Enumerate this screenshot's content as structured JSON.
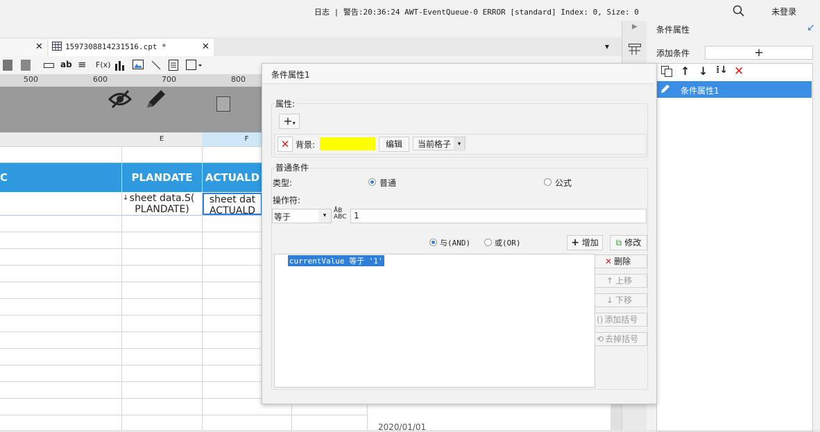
{
  "topbar": {
    "log": "日志 | 警告:20:36:24 AWT-EventQueue-0 ERROR [standard] Index: 0, Size: 0",
    "login": "未登录"
  },
  "tabs": [
    {
      "label": "1597308814231516.cpt *"
    }
  ],
  "ruler": [
    "500",
    "600",
    "700",
    "800"
  ],
  "grid": {
    "columns": [
      "E",
      "F"
    ],
    "header_cells": [
      "C",
      "PLANDATE",
      "ACTUALD"
    ],
    "row1_cells": [
      "sheet data.S(",
      "PLANDATE)",
      "sheet dat",
      "ACTUALD"
    ],
    "bottom_date": "2020/01/01"
  },
  "right_panel": {
    "title": "条件属性",
    "add_condition_label": "添加条件",
    "add_symbol": "+",
    "items": [
      "条件属性1"
    ]
  },
  "dialog": {
    "title": "条件属性1",
    "attr_group": "属性:",
    "add_symbol": "+",
    "background_label": "背景:",
    "background_color": "#ffff00",
    "edit_btn": "编辑",
    "scope_select": "当前格子",
    "normal_group": "普通条件",
    "type_label": "类型:",
    "type_normal": "普通",
    "type_formula": "公式",
    "operator_label": "操作符:",
    "operator_value": "等于",
    "value_input": "1",
    "and_label": "与(AND)",
    "or_label": "或(OR)",
    "add_btn": "增加",
    "modify_btn": "修改",
    "condition_text": "currentValue 等于 '1'",
    "delete_btn": "删除",
    "move_up_btn": "上移",
    "move_down_btn": "下移",
    "add_bracket_btn": "添加括号",
    "remove_bracket_btn": "去掉括号"
  }
}
